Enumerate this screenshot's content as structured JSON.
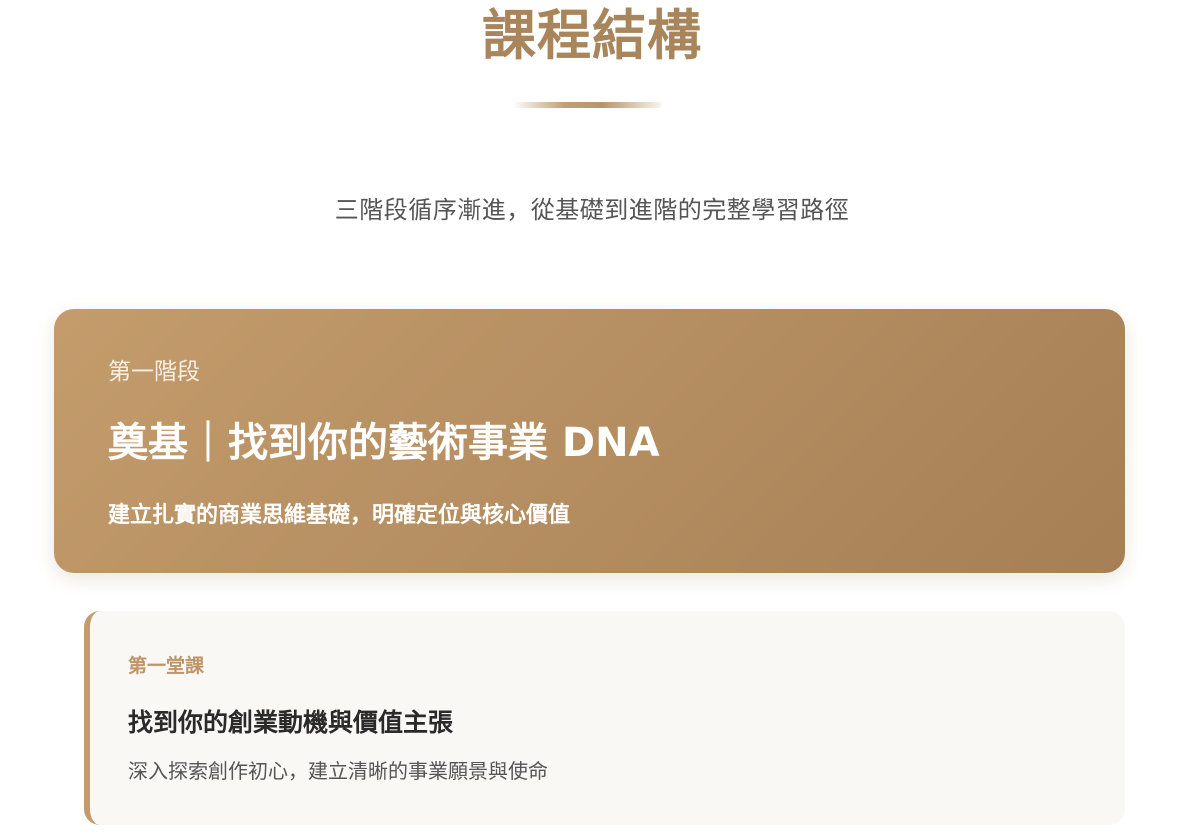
{
  "section": {
    "title": "課程結構",
    "subtitle": "三階段循序漸進，從基礎到進階的完整學習路徑"
  },
  "phase": {
    "label": "第一階段",
    "title": "奠基｜找到你的藝術事業 DNA",
    "description": "建立扎實的商業思維基礎，明確定位與核心價值"
  },
  "lesson": {
    "label": "第一堂課",
    "title": "找到你的創業動機與價值主張",
    "description": "深入探索創作初心，建立清晰的事業願景與使命"
  },
  "colors": {
    "accent": "#a8855a",
    "card_gradient_start": "#c49c6c",
    "card_gradient_end": "#a67f55",
    "lesson_background": "#faf8f4",
    "lesson_border": "#c29c6e",
    "text_dark": "#2a2a2a",
    "text_muted": "#555555"
  }
}
